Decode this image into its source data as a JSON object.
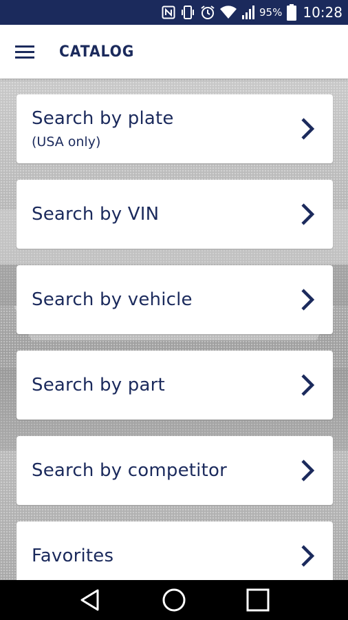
{
  "status_bar": {
    "battery_percent": "95%",
    "time": "10:28",
    "icons": [
      "nfc-icon",
      "vibrate-icon",
      "alarm-icon",
      "wifi-icon",
      "signal-icon",
      "battery-icon"
    ]
  },
  "app_bar": {
    "title": "CATALOG",
    "menu_icon": "hamburger-menu-icon"
  },
  "menu_items": [
    {
      "label": "Search by plate",
      "sublabel": "(USA only)",
      "icon": "chevron-right-icon"
    },
    {
      "label": "Search by VIN",
      "icon": "chevron-right-icon"
    },
    {
      "label": "Search by vehicle",
      "icon": "chevron-right-icon"
    },
    {
      "label": "Search by part",
      "icon": "chevron-right-icon"
    },
    {
      "label": "Search by competitor",
      "icon": "chevron-right-icon"
    },
    {
      "label": "Favorites",
      "icon": "chevron-right-icon"
    }
  ],
  "nav_bar": {
    "buttons": [
      "back-icon",
      "home-icon",
      "recents-icon"
    ]
  },
  "colors": {
    "brand": "#1b2a5c",
    "card": "#ffffff",
    "background": "#bcbcbc"
  }
}
